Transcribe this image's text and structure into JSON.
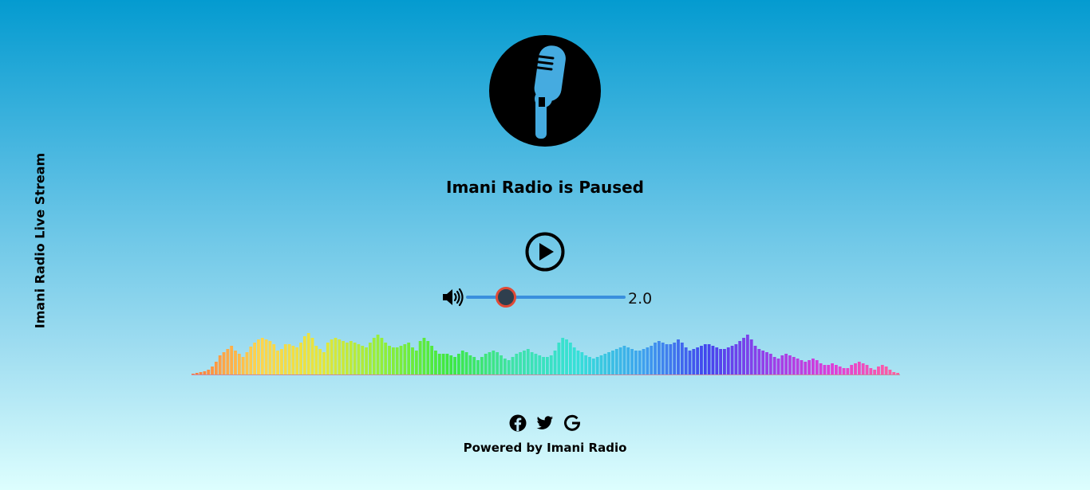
{
  "sidebar": {
    "title": "Imani Radio Live Stream"
  },
  "player": {
    "status_text": "Imani Radio is Paused",
    "state": "paused",
    "volume_value": "2.0",
    "volume_level": 0.25
  },
  "icons": {
    "logo": "microphone-icon",
    "play": "play-circle-icon",
    "volume": "volume-high-icon",
    "social": [
      "facebook-icon",
      "twitter-icon",
      "google-icon"
    ]
  },
  "visualizer": {
    "spectrum": "rainbow",
    "levels": [
      1,
      2,
      3,
      4,
      6,
      10,
      16,
      24,
      28,
      32,
      36,
      30,
      26,
      22,
      28,
      35,
      40,
      44,
      46,
      44,
      42,
      38,
      30,
      32,
      38,
      38,
      36,
      34,
      40,
      48,
      52,
      46,
      36,
      32,
      28,
      40,
      44,
      46,
      44,
      42,
      40,
      42,
      40,
      38,
      36,
      34,
      40,
      46,
      50,
      46,
      40,
      36,
      34,
      34,
      36,
      38,
      40,
      34,
      30,
      42,
      46,
      42,
      36,
      30,
      26,
      26,
      26,
      24,
      22,
      26,
      30,
      28,
      24,
      22,
      18,
      22,
      26,
      28,
      30,
      28,
      24,
      20,
      18,
      22,
      26,
      28,
      30,
      32,
      28,
      26,
      24,
      22,
      22,
      24,
      30,
      40,
      46,
      44,
      40,
      34,
      30,
      28,
      24,
      22,
      20,
      22,
      24,
      26,
      28,
      30,
      32,
      34,
      36,
      34,
      32,
      30,
      30,
      32,
      34,
      36,
      40,
      42,
      40,
      38,
      38,
      40,
      44,
      40,
      34,
      30,
      32,
      34,
      36,
      38,
      38,
      36,
      34,
      32,
      32,
      34,
      36,
      38,
      42,
      46,
      50,
      44,
      36,
      32,
      30,
      28,
      26,
      22,
      20,
      24,
      26,
      24,
      22,
      20,
      18,
      16,
      18,
      20,
      18,
      14,
      12,
      12,
      14,
      12,
      10,
      8,
      8,
      12,
      14,
      16,
      14,
      12,
      8,
      6,
      10,
      12,
      10,
      6,
      3,
      2
    ],
    "colors": [
      "#ff7a3d",
      "#ffd34d",
      "#e8e63a",
      "#8fee3a",
      "#3de83f",
      "#3fe3a8",
      "#36e0d8",
      "#3fa3ee",
      "#4245ee",
      "#9a3fe8",
      "#e03ed8",
      "#ff5f9e"
    ]
  },
  "footer": {
    "powered_text": "Powered by Imani Radio"
  }
}
